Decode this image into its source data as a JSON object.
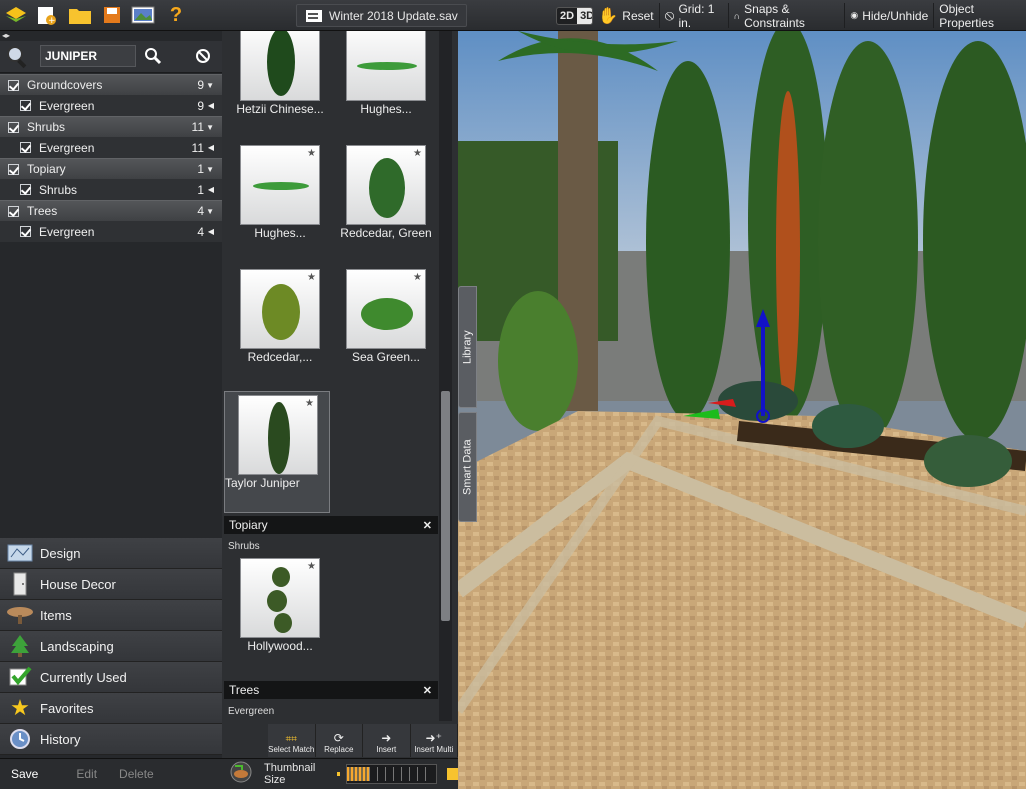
{
  "toolbar": {
    "filename": "Winter 2018 Update.sav",
    "view_2d": "2D",
    "view_3d": "3D",
    "reset": "Reset",
    "grid": "Grid: 1 in.",
    "snaps": "Snaps & Constraints",
    "hide_unhide": "Hide/Unhide",
    "object_properties": "Object Properties"
  },
  "search": {
    "value": "JUNIPER"
  },
  "tree": [
    {
      "label": "Groundcovers",
      "count": "9",
      "level": "cat"
    },
    {
      "label": "Evergreen",
      "count": "9",
      "level": "sub"
    },
    {
      "label": "Shrubs",
      "count": "11",
      "level": "cat"
    },
    {
      "label": "Evergreen",
      "count": "11",
      "level": "sub"
    },
    {
      "label": "Topiary",
      "count": "1",
      "level": "cat"
    },
    {
      "label": "Shrubs",
      "count": "1",
      "level": "sub"
    },
    {
      "label": "Trees",
      "count": "4",
      "level": "cat"
    },
    {
      "label": "Evergreen",
      "count": "4",
      "level": "sub"
    }
  ],
  "library": {
    "cards": [
      {
        "label": "Hetzii Chinese..."
      },
      {
        "label": "Hughes..."
      },
      {
        "label": "Hughes..."
      },
      {
        "label": "Redcedar, Green"
      },
      {
        "label": "Redcedar,..."
      },
      {
        "label": "Sea Green..."
      },
      {
        "label": "Taylor Juniper"
      }
    ],
    "section_topiary": "Topiary",
    "section_topiary_sub": "Shrubs",
    "topiary_card": "Hollywood...",
    "section_trees": "Trees",
    "section_trees_sub": "Evergreen"
  },
  "actions": {
    "select_match": "Select Match",
    "replace": "Replace",
    "insert": "Insert",
    "insert_multi": "Insert Multi"
  },
  "nav": [
    "Design",
    "House Decor",
    "Items",
    "Landscaping",
    "Currently Used",
    "Favorites",
    "History"
  ],
  "bottom": {
    "save": "Save",
    "edit": "Edit",
    "delete": "Delete",
    "thumbnail_size": "Thumbnail Size"
  },
  "sidetabs": {
    "library": "Library",
    "smart_data": "Smart Data"
  }
}
